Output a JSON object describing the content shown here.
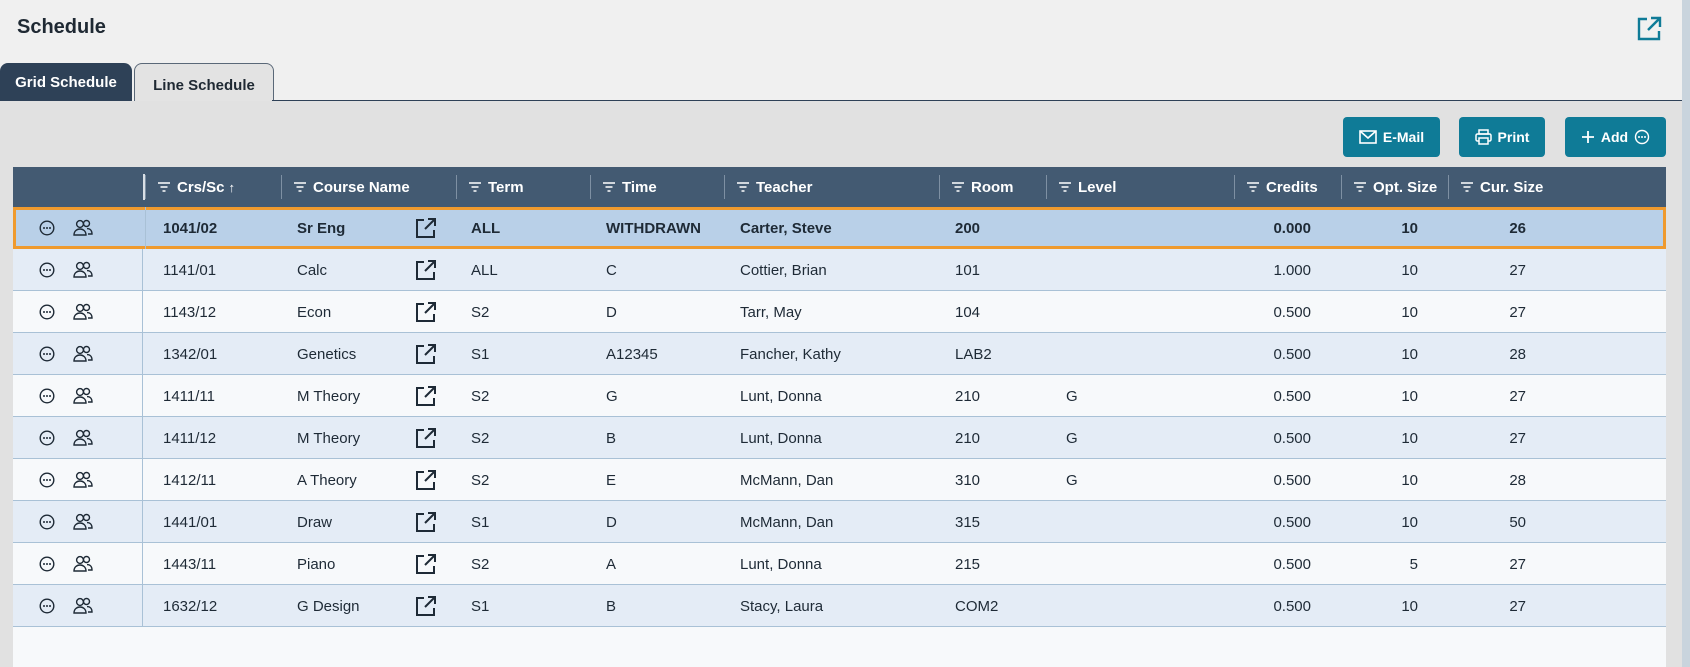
{
  "page": {
    "title": "Schedule"
  },
  "tabs": [
    {
      "label": "Grid Schedule"
    },
    {
      "label": "Line Schedule"
    }
  ],
  "toolbar": {
    "email_label": "E-Mail",
    "print_label": "Print",
    "add_label": "Add"
  },
  "colors": {
    "accent": "#0f7b97",
    "header_bg": "#435a72",
    "selected_row": "#b9d0e8",
    "selected_border": "#ef9a2e"
  },
  "table": {
    "columns": [
      {
        "key": "crs_sc",
        "label": "Crs/Sc",
        "sort": "↑"
      },
      {
        "key": "course_name",
        "label": "Course Name"
      },
      {
        "key": "term",
        "label": "Term"
      },
      {
        "key": "time",
        "label": "Time"
      },
      {
        "key": "teacher",
        "label": "Teacher"
      },
      {
        "key": "room",
        "label": "Room"
      },
      {
        "key": "level",
        "label": "Level"
      },
      {
        "key": "credits",
        "label": "Credits"
      },
      {
        "key": "opt_size",
        "label": "Opt. Size"
      },
      {
        "key": "cur_size",
        "label": "Cur. Size"
      }
    ],
    "rows": [
      {
        "crs_sc": "1041/02",
        "course_name": "Sr Eng",
        "term": "ALL",
        "time": "WITHDRAWN",
        "teacher": "Carter, Steve",
        "room": "200",
        "level": "",
        "credits": "0.000",
        "opt_size": "10",
        "cur_size": "26",
        "selected": true
      },
      {
        "crs_sc": "1141/01",
        "course_name": "Calc",
        "term": "ALL",
        "time": "C",
        "teacher": "Cottier, Brian",
        "room": "101",
        "level": "",
        "credits": "1.000",
        "opt_size": "10",
        "cur_size": "27"
      },
      {
        "crs_sc": "1143/12",
        "course_name": "Econ",
        "term": "S2",
        "time": "D",
        "teacher": "Tarr, May",
        "room": "104",
        "level": "",
        "credits": "0.500",
        "opt_size": "10",
        "cur_size": "27"
      },
      {
        "crs_sc": "1342/01",
        "course_name": "Genetics",
        "term": "S1",
        "time": "A12345",
        "teacher": "Fancher, Kathy",
        "room": "LAB2",
        "level": "",
        "credits": "0.500",
        "opt_size": "10",
        "cur_size": "28"
      },
      {
        "crs_sc": "1411/11",
        "course_name": "M Theory",
        "term": "S2",
        "time": "G",
        "teacher": "Lunt, Donna",
        "room": "210",
        "level": "G",
        "credits": "0.500",
        "opt_size": "10",
        "cur_size": "27"
      },
      {
        "crs_sc": "1411/12",
        "course_name": "M Theory",
        "term": "S2",
        "time": "B",
        "teacher": "Lunt, Donna",
        "room": "210",
        "level": "G",
        "credits": "0.500",
        "opt_size": "10",
        "cur_size": "27"
      },
      {
        "crs_sc": "1412/11",
        "course_name": "A Theory",
        "term": "S2",
        "time": "E",
        "teacher": "McMann, Dan",
        "room": "310",
        "level": "G",
        "credits": "0.500",
        "opt_size": "10",
        "cur_size": "28"
      },
      {
        "crs_sc": "1441/01",
        "course_name": "Draw",
        "term": "S1",
        "time": "D",
        "teacher": "McMann, Dan",
        "room": "315",
        "level": "",
        "credits": "0.500",
        "opt_size": "10",
        "cur_size": "50"
      },
      {
        "crs_sc": "1443/11",
        "course_name": "Piano",
        "term": "S2",
        "time": "A",
        "teacher": "Lunt, Donna",
        "room": "215",
        "level": "",
        "credits": "0.500",
        "opt_size": "5",
        "cur_size": "27"
      },
      {
        "crs_sc": "1632/12",
        "course_name": "G Design",
        "term": "S1",
        "time": "B",
        "teacher": "Stacy, Laura",
        "room": "COM2",
        "level": "",
        "credits": "0.500",
        "opt_size": "10",
        "cur_size": "27"
      }
    ]
  }
}
